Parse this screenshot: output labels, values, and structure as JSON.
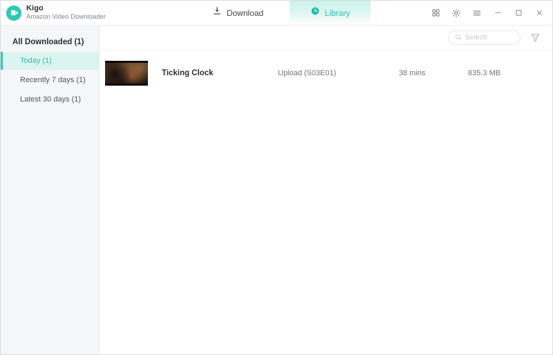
{
  "titlebar": {
    "brand_name": "Kigo",
    "brand_subtitle": "Amazon Video Downloader",
    "logo_icon": "kigo-logo-icon",
    "tabs": [
      {
        "label": "Download",
        "icon": "download-icon",
        "active": false
      },
      {
        "label": "Library",
        "icon": "library-clock-icon",
        "active": true
      }
    ],
    "window_controls": [
      {
        "name": "apps-grid-icon"
      },
      {
        "name": "gear-icon"
      },
      {
        "name": "menu-icon"
      },
      {
        "name": "minimize-icon"
      },
      {
        "name": "maximize-icon"
      },
      {
        "name": "close-icon"
      }
    ]
  },
  "sidebar": {
    "header": "All Downloaded (1)",
    "items": [
      {
        "label": "Today (1)",
        "active": true
      },
      {
        "label": "Recently 7 days (1)",
        "active": false
      },
      {
        "label": "Latest 30 days (1)",
        "active": false
      }
    ]
  },
  "toolbar": {
    "search_placeholder": "Search",
    "search_value": "",
    "search_icon": "search-icon",
    "filter_icon": "filter-icon"
  },
  "library": {
    "rows": [
      {
        "title": "Ticking Clock",
        "episode": "Upload (S03E01)",
        "duration": "38 mins",
        "size": "835.3 MB"
      }
    ]
  },
  "colors": {
    "accent": "#2ec9b0",
    "accent_text": "#2fbfa8",
    "active_bg": "#dcf4f0",
    "sidebar_bg": "#f5f6f7",
    "text_primary": "#2b2f33",
    "text_secondary": "#6e747a"
  }
}
